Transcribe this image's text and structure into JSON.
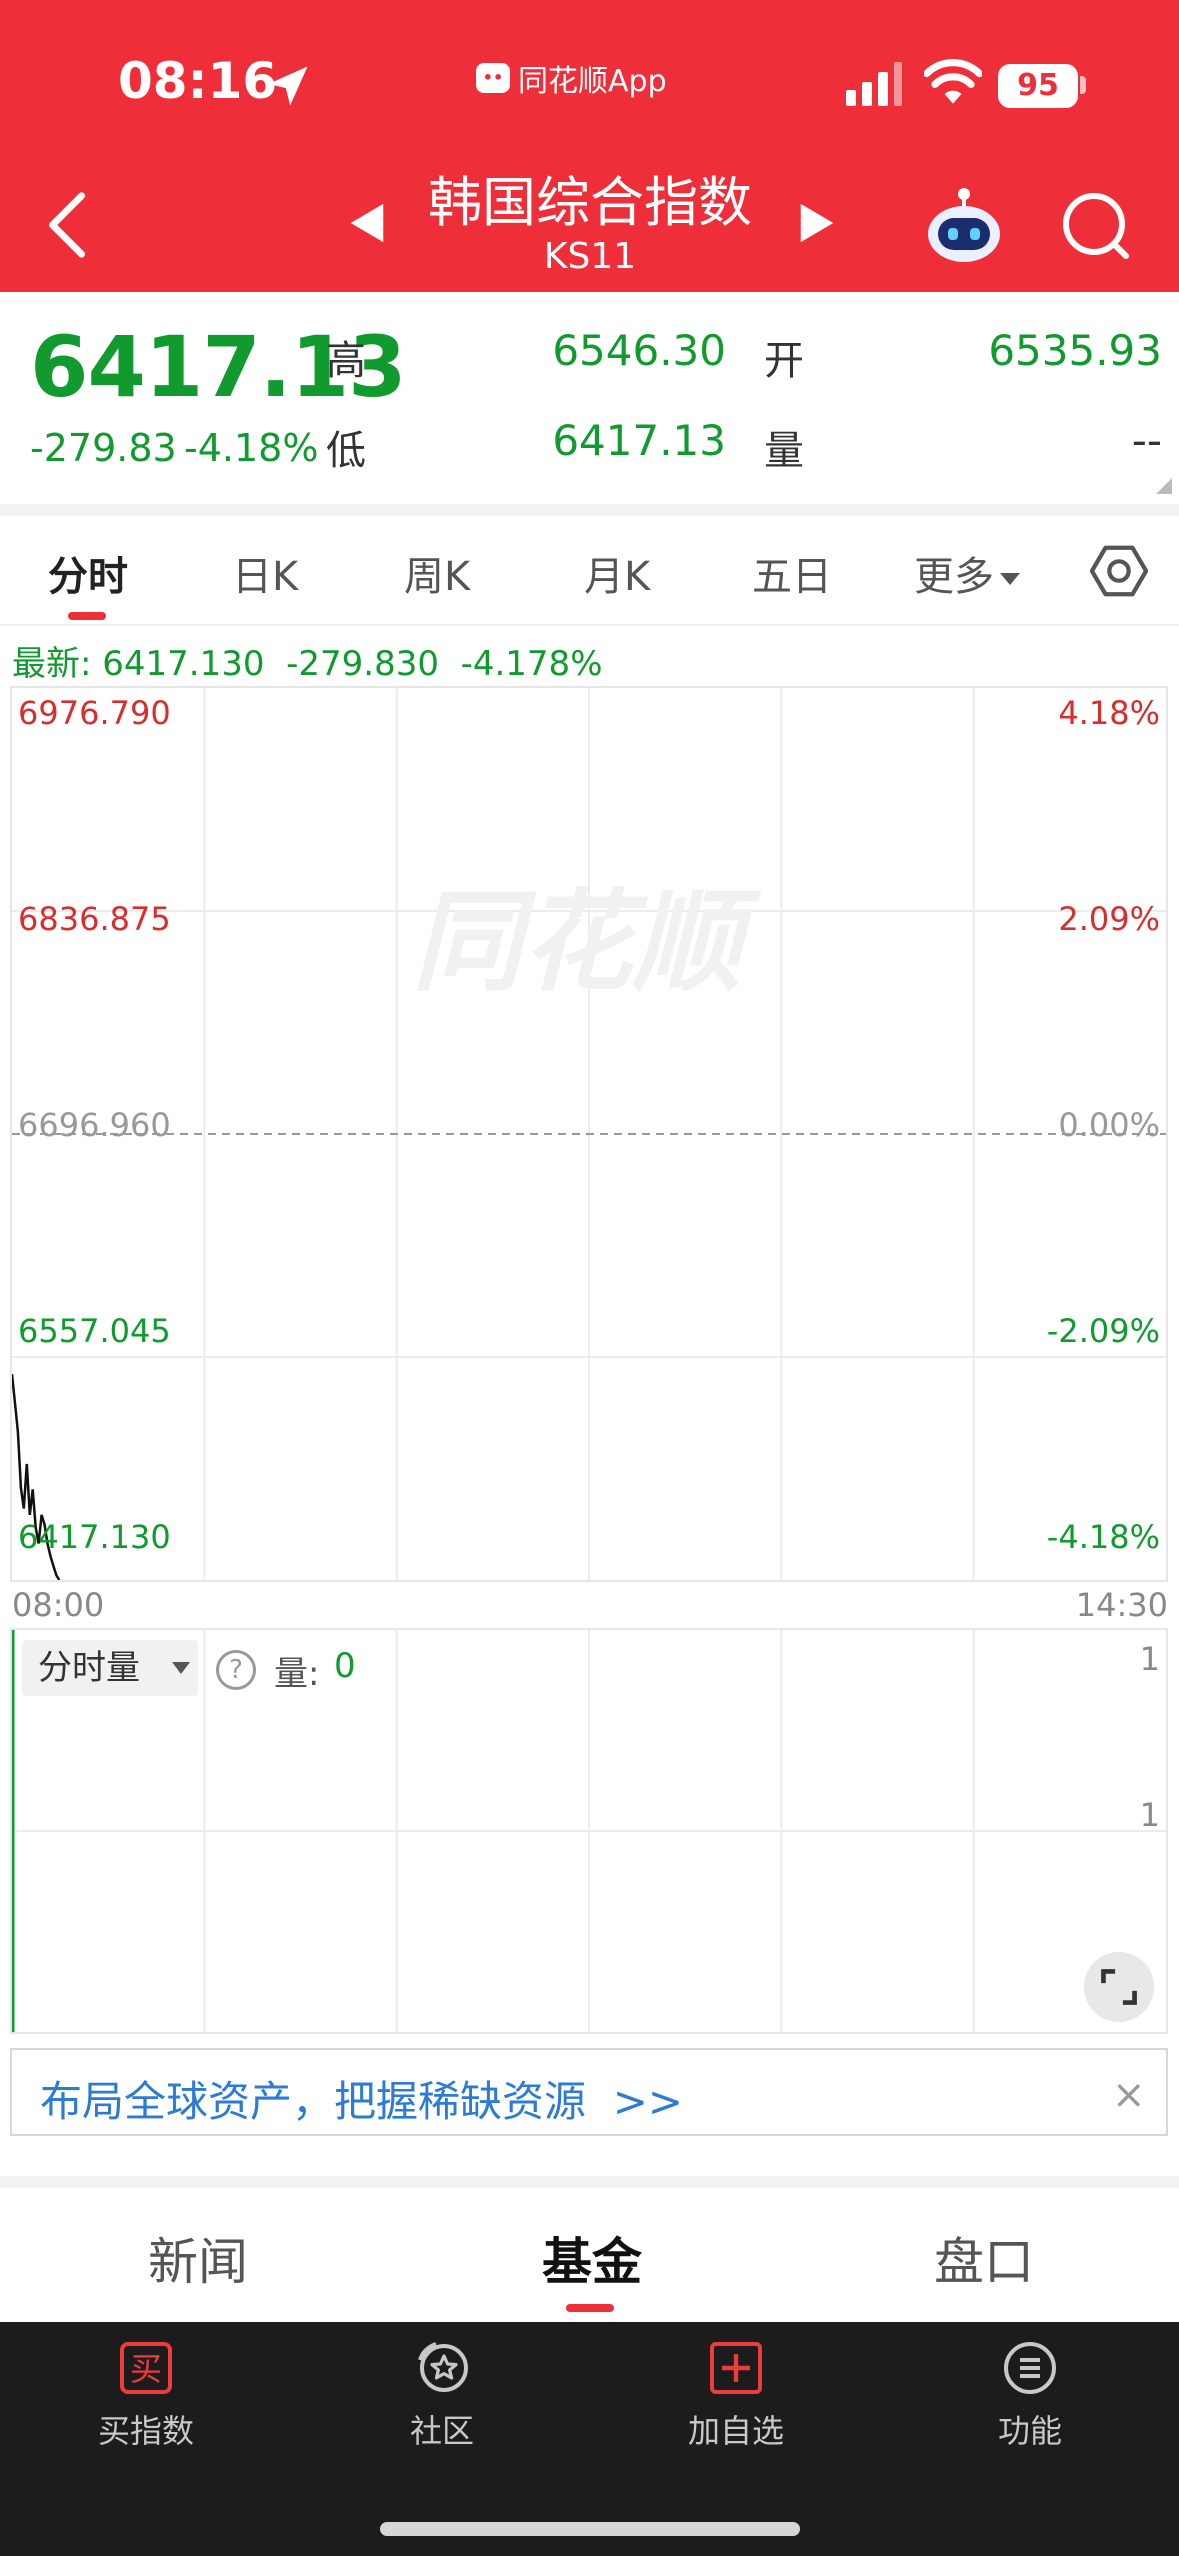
{
  "status_bar": {
    "time": "08:16",
    "app_label": "同花顺App",
    "battery": "95"
  },
  "header": {
    "title": "韩国综合指数",
    "code": "KS11"
  },
  "quote": {
    "price": "6417.13",
    "change": "-279.83",
    "change_pct": "-4.18%",
    "high_label": "高",
    "high": "6546.30",
    "low_label": "低",
    "low": "6417.13",
    "open_label": "开",
    "open": "6535.93",
    "volume_label": "量",
    "volume": "--"
  },
  "tabs": [
    {
      "label": "分时",
      "active": true
    },
    {
      "label": "日K"
    },
    {
      "label": "周K"
    },
    {
      "label": "月K"
    },
    {
      "label": "五日"
    },
    {
      "label": "更多"
    }
  ],
  "latest_line": "最新: 6417.130  -279.830  -4.178%",
  "chart": {
    "watermark": "同花顺",
    "y_left": [
      "6976.790",
      "6836.875",
      "6696.960",
      "6557.045",
      "6417.130"
    ],
    "y_right": [
      "4.18%",
      "2.09%",
      "0.00%",
      "-2.09%",
      "-4.18%"
    ],
    "x_start": "08:00",
    "x_end": "14:30"
  },
  "chart_data": {
    "type": "line",
    "x": [
      "08:00",
      "08:01",
      "08:02",
      "08:03",
      "08:04",
      "08:05",
      "08:06",
      "08:07",
      "08:08",
      "08:09",
      "08:10",
      "08:11",
      "08:12",
      "08:13",
      "08:14",
      "08:15",
      "08:16"
    ],
    "series": [
      {
        "values": [
          6546.3,
          6528.0,
          6510.0,
          6475.0,
          6462.0,
          6490.0,
          6458.0,
          6474.0,
          6450.0,
          6440.0,
          6458.0,
          6452.0,
          6440.0,
          6432.0,
          6426.0,
          6420.0,
          6417.13
        ]
      }
    ],
    "ylim": [
      6417.13,
      6976.79
    ],
    "y_ticks": [
      "6976.790",
      "6836.875",
      "6696.960",
      "6557.045",
      "6417.130"
    ],
    "y_ticks_right": [
      "4.18%",
      "2.09%",
      "0.00%",
      "-2.09%",
      "-4.18%"
    ],
    "x_ticks": [
      "08:00",
      "14:30"
    ],
    "reference_line": 6696.96,
    "grid": true
  },
  "volume": {
    "selector": "分时量",
    "help": "?",
    "label": "量:",
    "value": "0",
    "y_max": "1",
    "y_mid": "1"
  },
  "banner": {
    "text": "布局全球资产，把握稀缺资源  >>",
    "close": "×"
  },
  "sections": [
    {
      "label": "新闻"
    },
    {
      "label": "基金",
      "active": true
    },
    {
      "label": "盘口"
    }
  ],
  "bottom_bar": [
    {
      "label": "买指数",
      "icon": "buy-icon",
      "icon_text": "买"
    },
    {
      "label": "社区",
      "icon": "community-icon"
    },
    {
      "label": "加自选",
      "icon": "add-watchlist-icon"
    },
    {
      "label": "功能",
      "icon": "menu-icon"
    }
  ],
  "colors": {
    "brand_red": "#ee2f3a",
    "down_green": "#119a2e",
    "up_red": "#d92d2d",
    "link_blue": "#2e7bd6"
  }
}
